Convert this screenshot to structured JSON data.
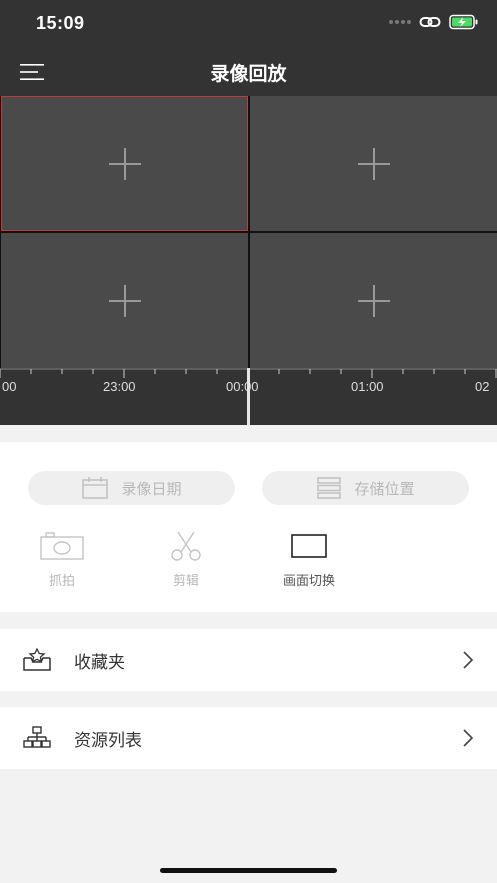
{
  "status": {
    "time": "15:09"
  },
  "nav": {
    "title": "录像回放",
    "menu_icon": "hamburger-icon"
  },
  "grid": {
    "cells": [
      {
        "icon": "plus-icon",
        "active": true
      },
      {
        "icon": "plus-icon",
        "active": false
      },
      {
        "icon": "plus-icon",
        "active": false
      },
      {
        "icon": "plus-icon",
        "active": false
      }
    ]
  },
  "timeline": {
    "labels": [
      "00",
      "23:00",
      "00:00",
      "01:00",
      "02"
    ]
  },
  "actions": {
    "record_date": "录像日期",
    "storage_location": "存储位置",
    "snapshot": "抓拍",
    "clip": "剪辑",
    "switch_view": "画面切换"
  },
  "list": {
    "favorites": "收藏夹",
    "resources": "资源列表"
  },
  "colors": {
    "header_bg": "#333333",
    "cell_bg": "#4a4a4a",
    "active_border": "#c23a3a",
    "disabled_text": "#b8b8b8"
  }
}
